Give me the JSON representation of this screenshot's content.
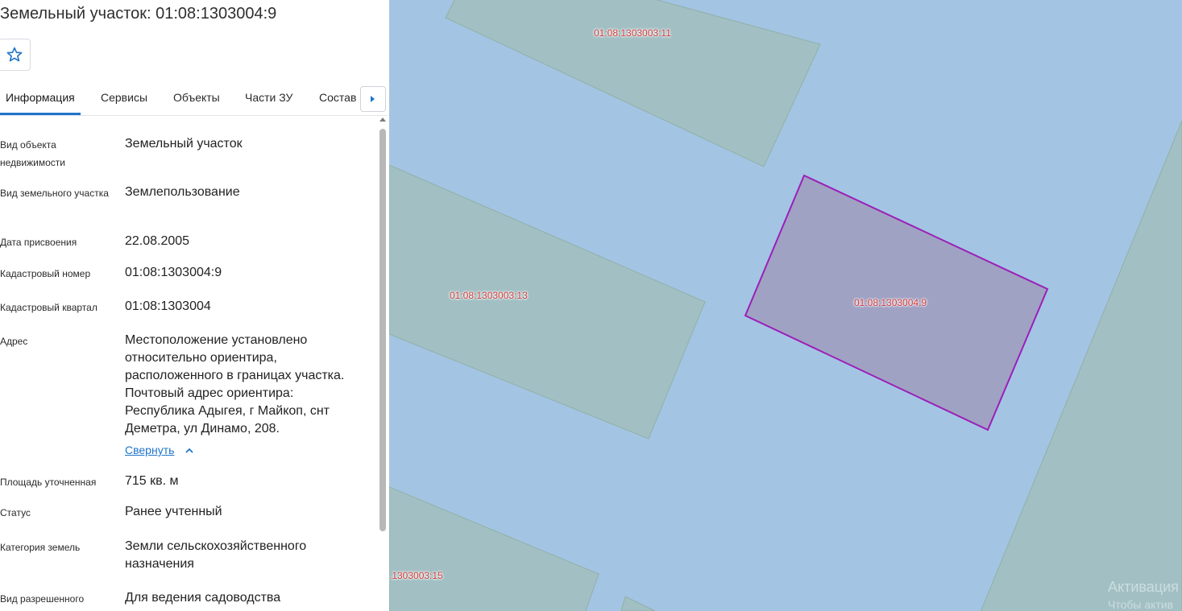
{
  "panel": {
    "title": "Земельный участок: 01:08:1303004:9",
    "favorite_icon": "star-outline-icon",
    "tabs": [
      {
        "label": "Информация"
      },
      {
        "label": "Сервисы"
      },
      {
        "label": "Объекты"
      },
      {
        "label": "Части ЗУ"
      },
      {
        "label": "Состав"
      }
    ],
    "rows": [
      {
        "label": "Вид объекта недвижимости",
        "value": "Земельный участок"
      },
      {
        "label": "Вид земельного участка",
        "value": "Землепользование"
      },
      {
        "label": "Дата присвоения",
        "value": "22.08.2005"
      },
      {
        "label": "Кадастровый номер",
        "value": "01:08:1303004:9"
      },
      {
        "label": "Кадастровый квартал",
        "value": "01:08:1303004"
      },
      {
        "label": "Адрес",
        "value": "Местоположение установлено относительно ориентира, расположенного в границах участка. Почтовый адрес ориентира: Республика Адыгея, г Майкоп, снт Деметра, ул Динамо, 208."
      },
      {
        "label": "Площадь уточненная",
        "value": "715 кв. м"
      },
      {
        "label": "Статус",
        "value": "Ранее учтенный"
      },
      {
        "label": "Категория земель",
        "value": "Земли сельскохозяйственного назначения"
      },
      {
        "label": "Вид разрешенного",
        "value": "Для ведения садоводства"
      }
    ],
    "collapse_label": "Свернуть"
  },
  "map": {
    "colors": {
      "water": "#a4c4e3",
      "parcel": "#a2c0c4",
      "selected_fill": "#a0a2c4",
      "selected_border": "#9b1fb8",
      "label": "#d03a3a"
    },
    "parcel_labels": [
      "01:08:1303003:11",
      "01:08:1303003:13",
      "01:08:1303004:9",
      ".1303003:15"
    ],
    "watermark": [
      "Активация",
      "Чтобы актив"
    ]
  }
}
